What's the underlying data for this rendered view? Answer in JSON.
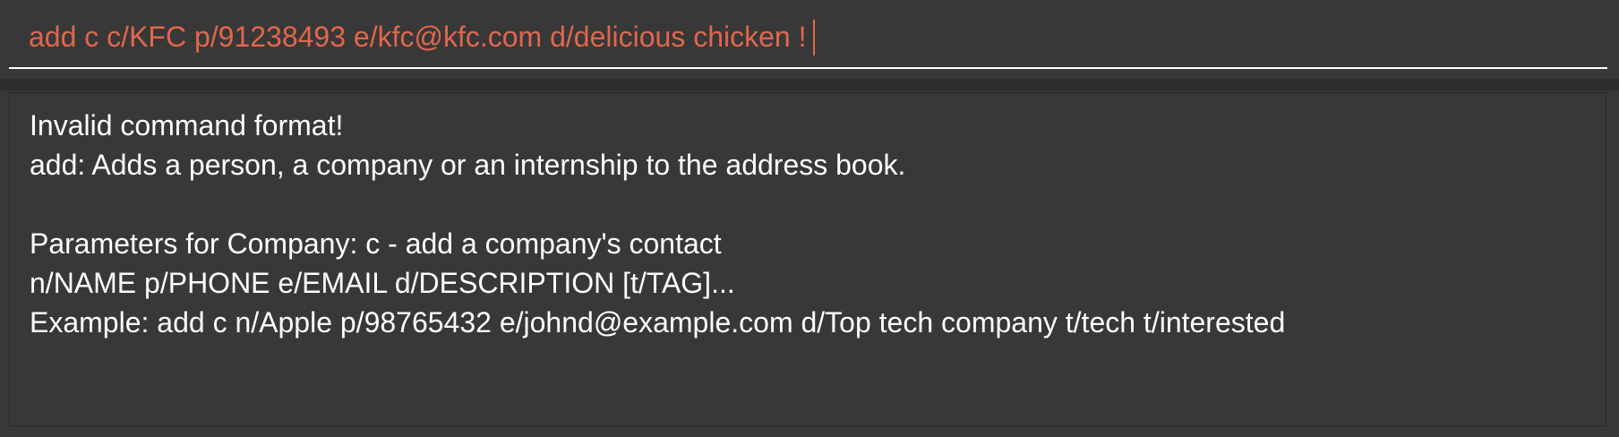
{
  "command_box": {
    "value": "add c c/KFC p/91238493 e/kfc@kfc.com d/delicious chicken !"
  },
  "result_display": {
    "lines": [
      "Invalid command format!",
      "add: Adds a person, a company or an internship to the address book.",
      "",
      "Parameters for Company: c - add a company's contact",
      "n/NAME p/PHONE e/EMAIL d/DESCRIPTION [t/TAG]...",
      "Example: add c n/Apple p/98765432 e/johnd@example.com d/Top tech company t/tech t/interested"
    ]
  },
  "colors": {
    "background": "#383838",
    "command_text": "#e0674c",
    "result_text": "#ffffff"
  }
}
